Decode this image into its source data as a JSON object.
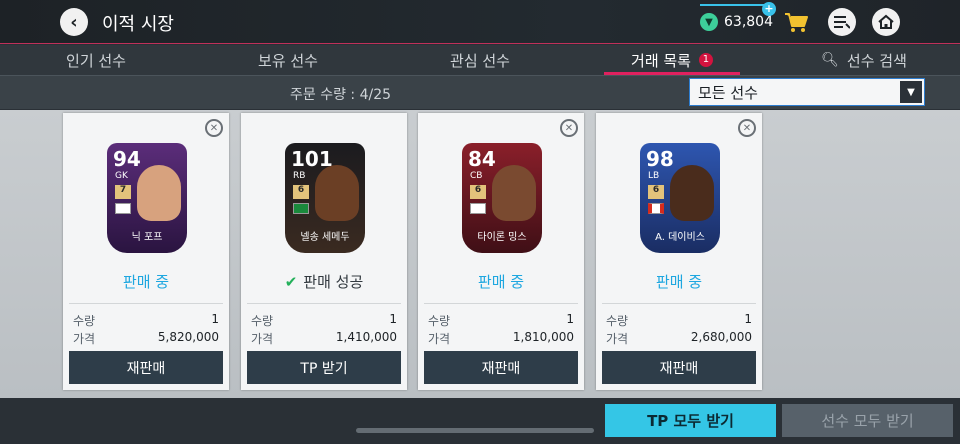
{
  "header": {
    "title": "이적 시장",
    "tp_value": "63,804"
  },
  "tabs": [
    {
      "label": "인기 선수"
    },
    {
      "label": "보유 선수"
    },
    {
      "label": "관심 선수"
    },
    {
      "label": "거래 목록",
      "badge": "1"
    },
    {
      "label": "선수 검색"
    }
  ],
  "orders": {
    "text": "주문 수량 : 4/25",
    "filter_value": "모든 선수"
  },
  "cards": [
    {
      "ovr": "94",
      "position": "GK",
      "level": "7",
      "name": "닉 포프",
      "status": "판매 중",
      "qty_label": "수량",
      "qty": "1",
      "price_label": "가격",
      "price": "5,820,000",
      "button": "재판매"
    },
    {
      "ovr": "101",
      "position": "RB",
      "level": "6",
      "name": "넬송 세메두",
      "status": "판매 성공",
      "qty_label": "수량",
      "qty": "1",
      "price_label": "가격",
      "price": "1,410,000",
      "button": "TP 받기"
    },
    {
      "ovr": "84",
      "position": "CB",
      "level": "6",
      "name": "타이론 밍스",
      "status": "판매 중",
      "qty_label": "수량",
      "qty": "1",
      "price_label": "가격",
      "price": "1,810,000",
      "button": "재판매"
    },
    {
      "ovr": "98",
      "position": "LB",
      "level": "6",
      "name": "A. 데이비스",
      "status": "판매 중",
      "qty_label": "수량",
      "qty": "1",
      "price_label": "가격",
      "price": "2,680,000",
      "button": "재판매"
    }
  ],
  "bottom": {
    "receive_all_tp": "TP 모두 받기",
    "receive_all_players": "선수 모두 받기"
  },
  "colors": {
    "accent_cyan": "#34c6e6",
    "tab_underline": "#e0215f",
    "status_selling": "#1ea7e0",
    "status_success_check": "#23b05a"
  },
  "icons": [
    "back-icon",
    "tp-coin-icon",
    "cart-icon",
    "list-icon",
    "home-icon",
    "search-icon",
    "close-icon",
    "check-icon",
    "chevron-down-icon"
  ]
}
